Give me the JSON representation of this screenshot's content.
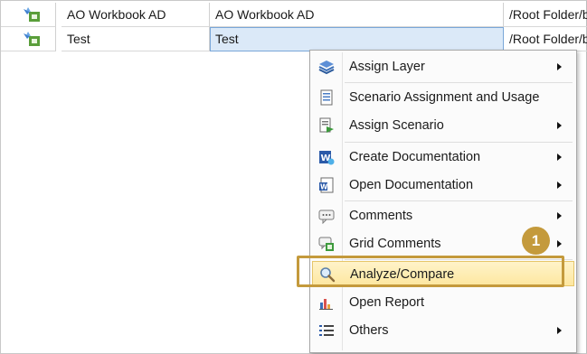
{
  "grid": {
    "rows": [
      {
        "name": "AO Workbook AD",
        "description": "AO Workbook AD",
        "path": "/Root Folder/b",
        "selected": false
      },
      {
        "name": "Test",
        "description": "Test",
        "path": "/Root Folder/b",
        "selected": true
      }
    ]
  },
  "context_menu": {
    "items": [
      {
        "label": "Assign Layer",
        "icon": "layers-icon",
        "has_submenu": true
      },
      {
        "label": "Scenario Assignment and Usage",
        "icon": "document-list-icon",
        "has_submenu": false
      },
      {
        "label": "Assign Scenario",
        "icon": "assign-scenario-icon",
        "has_submenu": true
      },
      {
        "label": "Create Documentation",
        "icon": "word-create-icon",
        "has_submenu": true
      },
      {
        "label": "Open Documentation",
        "icon": "word-document-icon",
        "has_submenu": true
      },
      {
        "label": "Comments",
        "icon": "comment-bubble-icon",
        "has_submenu": true
      },
      {
        "label": "Grid Comments",
        "icon": "grid-comments-icon",
        "has_submenu": true
      },
      {
        "label": "Analyze/Compare",
        "icon": "magnifier-icon",
        "has_submenu": false,
        "highlighted": true
      },
      {
        "label": "Open Report",
        "icon": "report-chart-icon",
        "has_submenu": false
      },
      {
        "label": "Others",
        "icon": "list-icon",
        "has_submenu": true
      }
    ]
  },
  "callout": {
    "number": "1"
  },
  "colors": {
    "callout": "#c49a3c",
    "highlight": "#fde7a0",
    "selection": "#dbe9f8"
  }
}
